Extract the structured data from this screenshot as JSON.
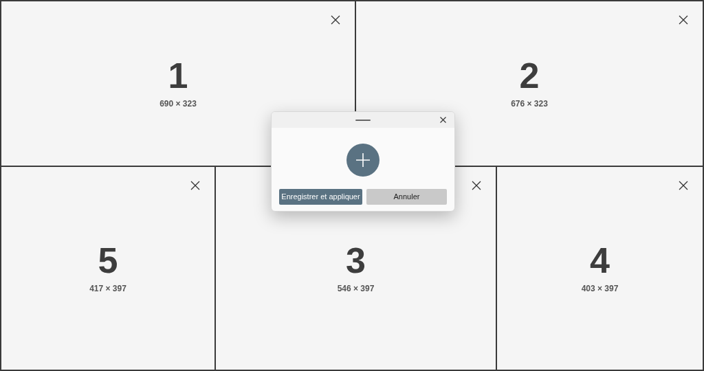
{
  "zones": [
    {
      "number": "1",
      "size": "690 × 323"
    },
    {
      "number": "2",
      "size": "676 × 323"
    },
    {
      "number": "5",
      "size": "417 × 397"
    },
    {
      "number": "3",
      "size": "546 × 397"
    },
    {
      "number": "4",
      "size": "403 × 397"
    }
  ],
  "dialog": {
    "buttons": [
      {
        "label": "Enregistrer et appliquer",
        "kind": "primary"
      },
      {
        "label": "Annuler",
        "kind": "secondary"
      }
    ]
  }
}
